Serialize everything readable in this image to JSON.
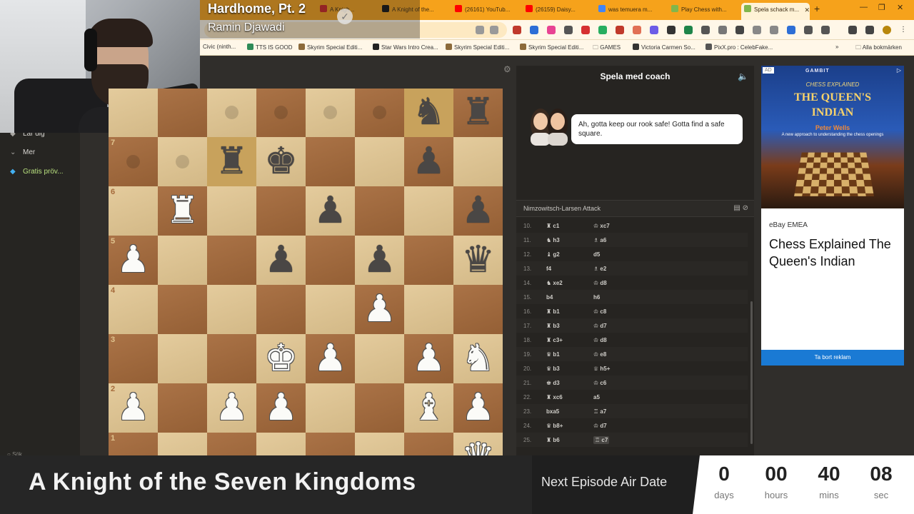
{
  "browser": {
    "tabs": [
      {
        "label": "A Knigh...",
        "color": "#cc2222"
      },
      {
        "label": "A Knight of the...",
        "color": "#111111"
      },
      {
        "label": "(26161) YouTub...",
        "color": "#ff0000"
      },
      {
        "label": "(26159) Daisy...",
        "color": "#ff0000"
      },
      {
        "label": "was temuera m...",
        "color": "#4285f4"
      },
      {
        "label": "Play Chess with...",
        "color": "#81b64c"
      },
      {
        "label": "Spela schack m...",
        "color": "#81b64c"
      }
    ],
    "new_tab": "+",
    "bookmarks": [
      "Civic (ninth...",
      "TTS IS GOOD",
      "Skyrim Special Editi...",
      "Star Wars Intro Crea...",
      "Skyrim Special Editi...",
      "Skyrim Special Editi...",
      "GAMES",
      "Victoria Carmen So...",
      "PixX.pro : CelebFake...",
      "Alla bokmärken"
    ],
    "bookmarks_overflow": "»"
  },
  "now_playing": {
    "title": "Hardhome, Pt. 2",
    "artist": "Ramin Djawadi",
    "check_icon": "✓"
  },
  "sidebar": {
    "items": [
      {
        "icon": "◆",
        "label": "Lär dig"
      },
      {
        "icon": "⌄",
        "label": "Mer"
      },
      {
        "icon": "◆",
        "label": "Gratis pröv..."
      }
    ],
    "search": "Sök"
  },
  "board": {
    "rank_labels": [
      "7",
      "6",
      "5",
      "4",
      "3",
      "2",
      "1"
    ],
    "settings_icon": "⚙"
  },
  "coach": {
    "title": "Spela med coach",
    "message": "Ah, gotta keep our rook safe! Gotta find a safe square.",
    "opening": "Nimzowitsch-Larsen Attack",
    "moves": [
      {
        "num": "10.",
        "white": "♜ c1",
        "black": "♔ xc7"
      },
      {
        "num": "11.",
        "white": "♞ h3",
        "black": "♗ a6"
      },
      {
        "num": "12.",
        "white": "♝ g2",
        "black": "d5"
      },
      {
        "num": "13.",
        "white": "f4",
        "black": "♗ e2"
      },
      {
        "num": "14.",
        "white": "♞ xe2",
        "black": "♔ d8"
      },
      {
        "num": "15.",
        "white": "b4",
        "black": "h6"
      },
      {
        "num": "16.",
        "white": "♜ b1",
        "black": "♔ c8"
      },
      {
        "num": "17.",
        "white": "♜ b3",
        "black": "♔ d7"
      },
      {
        "num": "18.",
        "white": "♜ c3+",
        "black": "♔ d8"
      },
      {
        "num": "19.",
        "white": "♛ b1",
        "black": "♔ e8"
      },
      {
        "num": "20.",
        "white": "♛ b3",
        "black": "♕ h5+"
      },
      {
        "num": "21.",
        "white": "♚ d3",
        "black": "♔ c6"
      },
      {
        "num": "22.",
        "white": "♜ xc6",
        "black": "a5"
      },
      {
        "num": "23.",
        "white": "bxa5",
        "black": "♖ a7"
      },
      {
        "num": "24.",
        "white": "♛ b8+",
        "black": "♔ d7"
      },
      {
        "num": "25.",
        "white": "♜ b6",
        "black": "♖ c7"
      }
    ]
  },
  "ad": {
    "badge": "AD",
    "publisher": "GAMBIT",
    "series": "CHESS EXPLAINED",
    "book_title_1": "THE QUEEN'S",
    "book_title_2": "INDIAN",
    "author": "Peter Wells",
    "book_subtitle": "A new approach to understanding the chess openings",
    "seller": "eBay EMEA",
    "title": "Chess Explained The Queen's Indian",
    "button": "Ta bort reklam"
  },
  "banner": {
    "show_title": "A Knight of the Seven Kingdoms",
    "next_label": "Next Episode Air Date",
    "countdown": [
      {
        "value": "0",
        "unit": "days"
      },
      {
        "value": "00",
        "unit": "hours"
      },
      {
        "value": "40",
        "unit": "mins"
      },
      {
        "value": "08",
        "unit": "sec"
      }
    ]
  },
  "colors": {
    "browser_accent": "#f6a21b",
    "board_light": "#e0c48f",
    "board_dark": "#a56a3b",
    "ad_button": "#1a7ad4"
  }
}
